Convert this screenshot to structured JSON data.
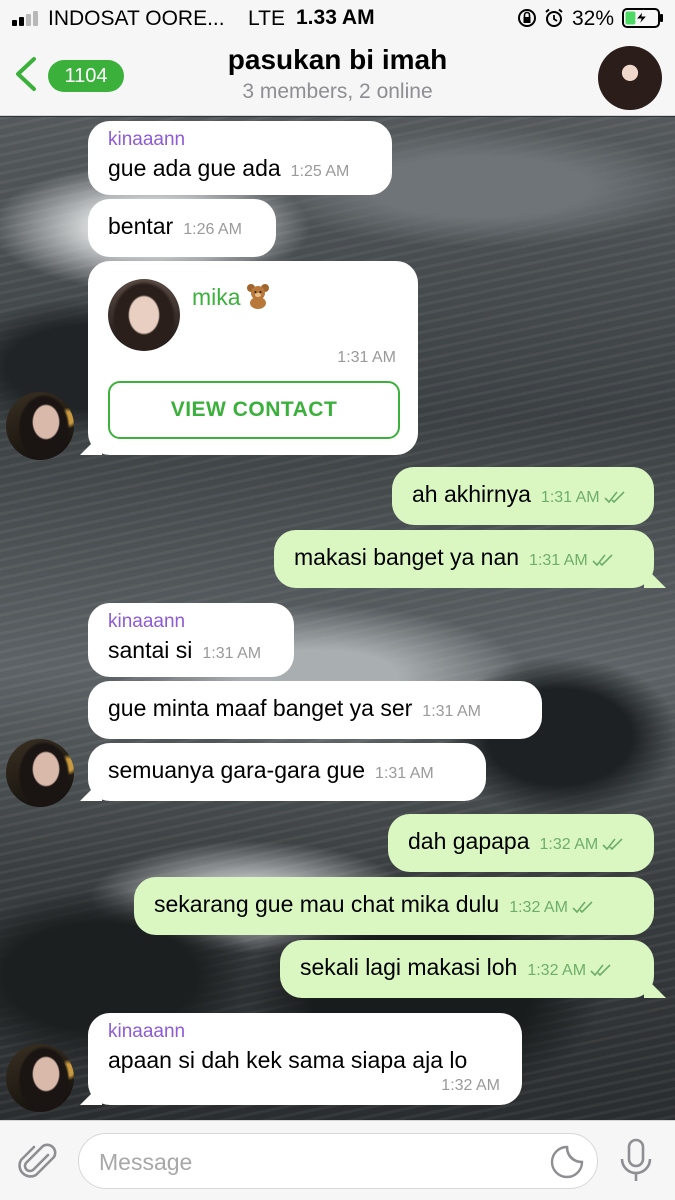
{
  "status_bar": {
    "carrier": "INDOSAT OORE...",
    "network": "LTE",
    "time": "1.33 AM",
    "battery_percent": "32%",
    "battery_level": 0.32,
    "signal_bars_active": 2,
    "icons": [
      "lock-rotation-icon",
      "alarm-icon",
      "battery-charging-icon"
    ]
  },
  "header": {
    "back_count": "1104",
    "title": "pasukan bi imah",
    "subtitle": "3 members, 2 online",
    "avatar_icon": "group-avatar"
  },
  "messages": [
    {
      "side": "in",
      "sender": "kinaaann",
      "text": "gue ada gue ada",
      "time": "1:25 AM"
    },
    {
      "side": "in",
      "text": "bentar",
      "time": "1:26 AM"
    },
    {
      "side": "in",
      "type": "contact",
      "contact_name": "mika",
      "contact_emoji": "teddy-bear-icon",
      "time": "1:31 AM",
      "button_label": "VIEW CONTACT"
    },
    {
      "side": "out",
      "text": "ah akhirnya",
      "time": "1:31 AM",
      "status": "read"
    },
    {
      "side": "out",
      "text": "makasi banget ya nan",
      "time": "1:31 AM",
      "status": "read"
    },
    {
      "side": "in",
      "sender": "kinaaann",
      "text": "santai si",
      "time": "1:31 AM"
    },
    {
      "side": "in",
      "text": "gue minta maaf banget ya ser",
      "time": "1:31 AM"
    },
    {
      "side": "in",
      "text": "semuanya gara-gara gue",
      "time": "1:31 AM"
    },
    {
      "side": "out",
      "text": "dah gapapa",
      "time": "1:32 AM",
      "status": "read"
    },
    {
      "side": "out",
      "text": "sekarang gue mau chat mika dulu",
      "time": "1:32 AM",
      "status": "read"
    },
    {
      "side": "out",
      "text": "sekali lagi makasi loh",
      "time": "1:32 AM",
      "status": "read"
    },
    {
      "side": "in",
      "sender": "kinaaann",
      "text": "apaan si dah kek sama siapa aja lo",
      "time": "1:32 AM"
    }
  ],
  "input_bar": {
    "placeholder": "Message",
    "value": "",
    "icons": [
      "paperclip-icon",
      "sticker-icon",
      "microphone-icon"
    ]
  },
  "colors": {
    "accent_green": "#3bb13c",
    "outgoing_bubble": "#daf7c2",
    "incoming_bubble": "#ffffff",
    "sender_name": "#8e5bd4"
  }
}
